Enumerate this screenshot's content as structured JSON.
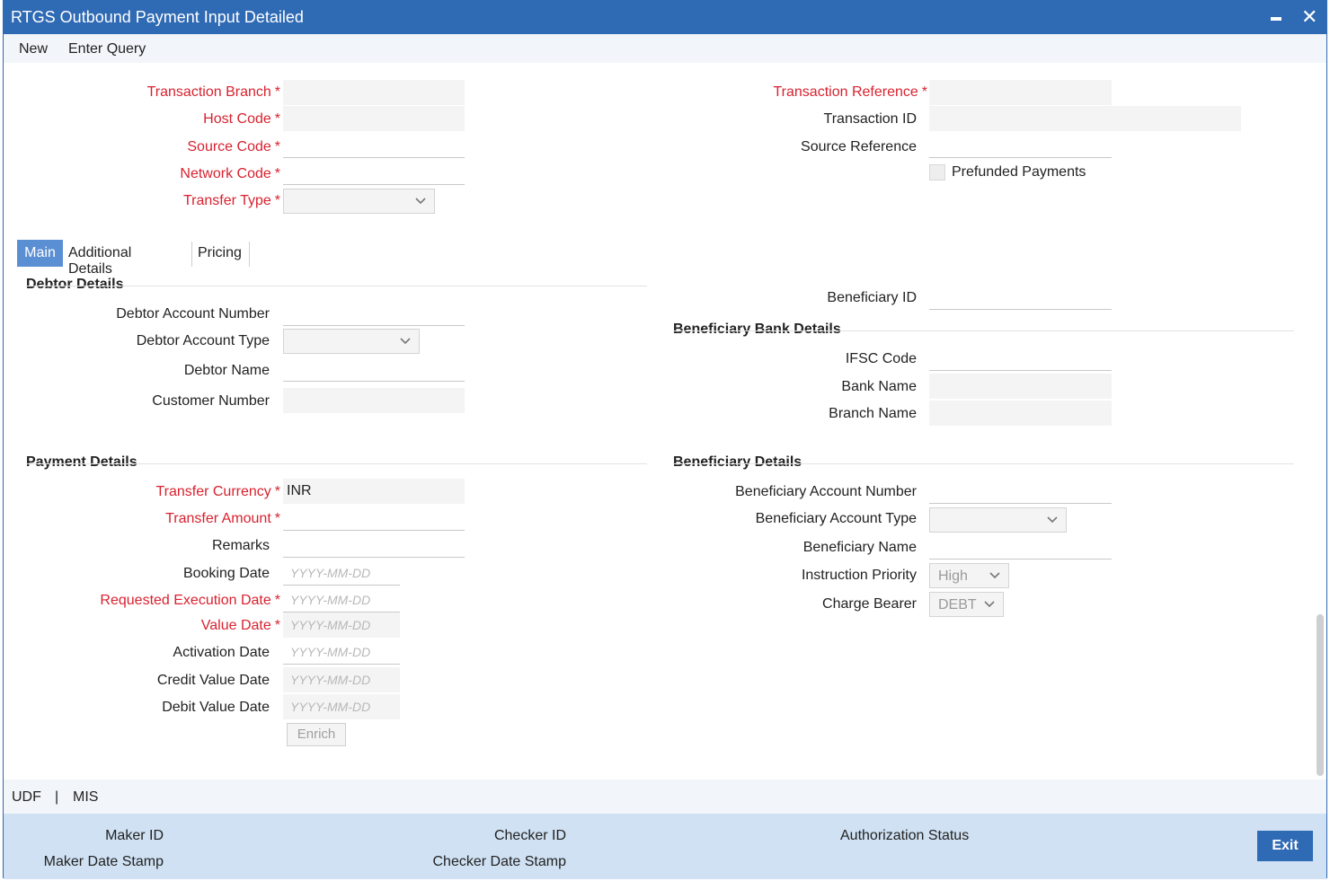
{
  "window": {
    "title": "RTGS Outbound Payment Input Detailed"
  },
  "menu": {
    "new": "New",
    "enter_query": "Enter Query"
  },
  "header_left": {
    "transaction_branch": "Transaction Branch",
    "host_code": "Host Code",
    "source_code": "Source Code",
    "network_code": "Network Code",
    "transfer_type": "Transfer Type"
  },
  "header_right": {
    "transaction_reference": "Transaction Reference",
    "transaction_id": "Transaction ID",
    "source_reference": "Source Reference",
    "prefunded_payments": "Prefunded Payments"
  },
  "required_marker": "*",
  "tabs": {
    "main": "Main",
    "additional_details": "Additional Details",
    "pricing": "Pricing"
  },
  "debtor": {
    "title": "Debtor Details",
    "account_number": "Debtor Account Number",
    "account_type": "Debtor Account Type",
    "name": "Debtor Name",
    "customer_number": "Customer Number"
  },
  "beneficiary_id": {
    "label": "Beneficiary ID"
  },
  "beneficiary_bank": {
    "title": "Beneficiary Bank Details",
    "ifsc_code": "IFSC Code",
    "bank_name": "Bank Name",
    "branch_name": "Branch Name"
  },
  "payment": {
    "title": "Payment Details",
    "transfer_currency": "Transfer Currency",
    "transfer_currency_value": "INR",
    "transfer_amount": "Transfer Amount",
    "remarks": "Remarks",
    "booking_date": "Booking Date",
    "requested_execution_date": "Requested Execution Date",
    "value_date": "Value Date",
    "activation_date": "Activation Date",
    "credit_value_date": "Credit Value Date",
    "debit_value_date": "Debit Value Date",
    "date_placeholder": "YYYY-MM-DD",
    "enrich_button": "Enrich"
  },
  "beneficiary": {
    "title": "Beneficiary Details",
    "account_number": "Beneficiary Account Number",
    "account_type": "Beneficiary Account Type",
    "name": "Beneficiary Name",
    "instruction_priority": "Instruction Priority",
    "instruction_priority_value": "High",
    "charge_bearer": "Charge Bearer",
    "charge_bearer_value": "DEBT"
  },
  "bottom_links": {
    "udf": "UDF",
    "separator": "|",
    "mis": "MIS"
  },
  "footer": {
    "maker_id": "Maker ID",
    "maker_date_stamp": "Maker Date Stamp",
    "checker_id": "Checker ID",
    "checker_date_stamp": "Checker Date Stamp",
    "authorization_status": "Authorization Status",
    "exit_button": "Exit"
  },
  "colors": {
    "title_bar": "#2f6ab4",
    "required_label": "#d8222f",
    "active_tab": "#5b8fd3",
    "footer": "#cfe1f3"
  },
  "icons": {
    "minimize": "minimize-icon",
    "close": "close-icon",
    "dropdown": "chevron-down-icon"
  }
}
